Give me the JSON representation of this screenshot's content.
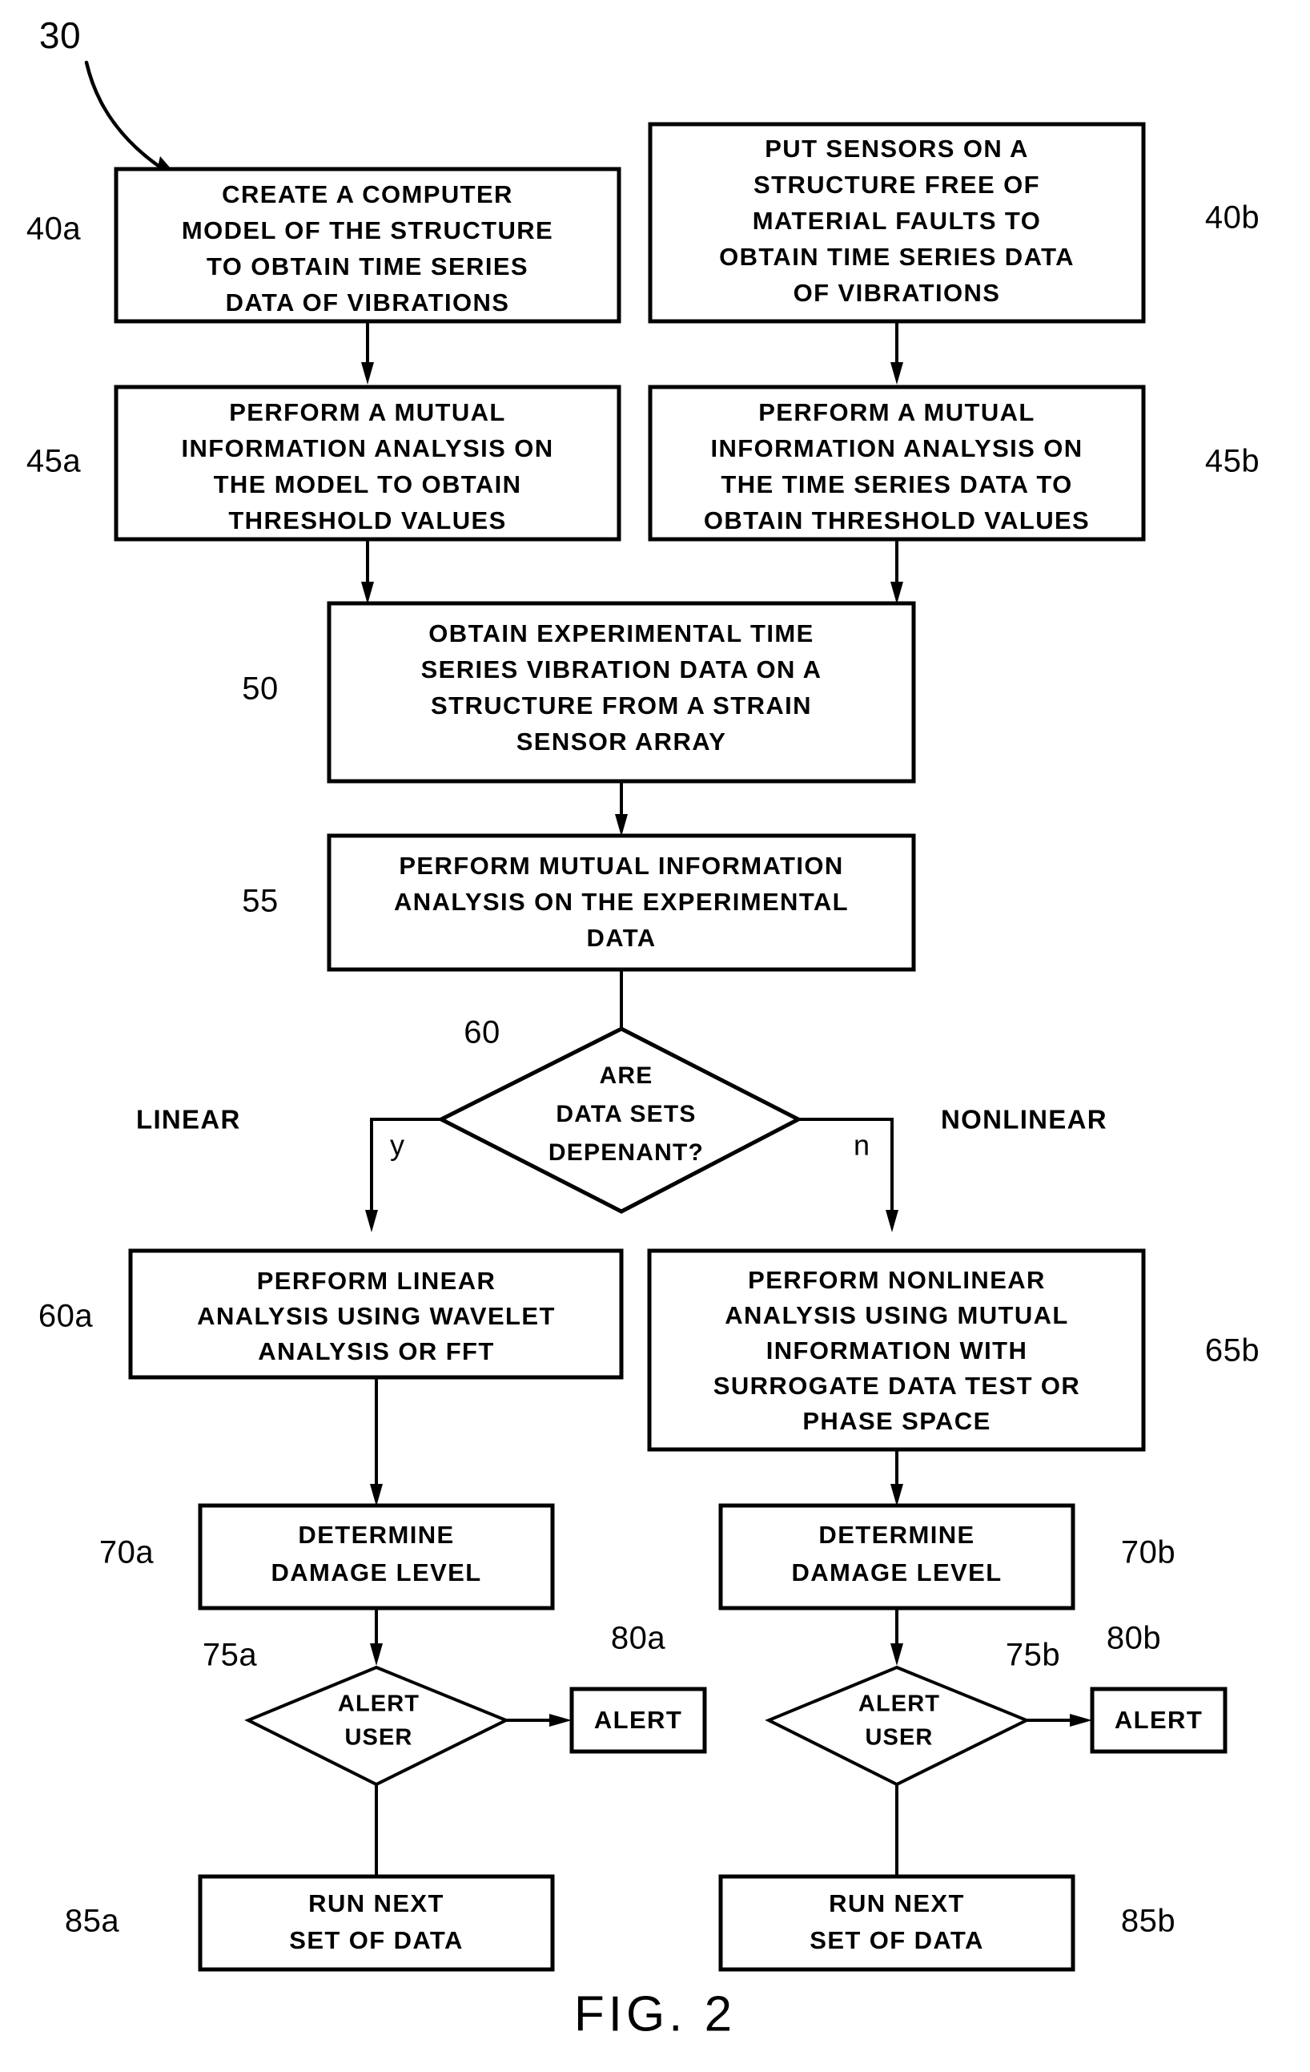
{
  "figure": {
    "caption": "FIG.  2",
    "diagram_ref": "30"
  },
  "nodes": {
    "n40a": {
      "ref": "40a",
      "type": "process",
      "lines": [
        "CREATE A COMPUTER",
        "MODEL OF THE STRUCTURE",
        "TO OBTAIN TIME SERIES",
        "DATA OF VIBRATIONS"
      ]
    },
    "n40b": {
      "ref": "40b",
      "type": "process",
      "lines": [
        "PUT SENSORS ON A",
        "STRUCTURE FREE OF",
        "MATERIAL FAULTS TO",
        "OBTAIN TIME SERIES DATA",
        "OF VIBRATIONS"
      ]
    },
    "n45a": {
      "ref": "45a",
      "type": "process",
      "lines": [
        "PERFORM A MUTUAL",
        "INFORMATION ANALYSIS ON",
        "THE MODEL TO OBTAIN",
        "THRESHOLD VALUES"
      ]
    },
    "n45b": {
      "ref": "45b",
      "type": "process",
      "lines": [
        "PERFORM A MUTUAL",
        "INFORMATION ANALYSIS ON",
        "THE TIME SERIES DATA TO",
        "OBTAIN THRESHOLD VALUES"
      ]
    },
    "n50": {
      "ref": "50",
      "type": "process",
      "lines": [
        "OBTAIN EXPERIMENTAL TIME",
        "SERIES VIBRATION DATA ON A",
        "STRUCTURE FROM A STRAIN",
        "SENSOR ARRAY"
      ]
    },
    "n55": {
      "ref": "55",
      "type": "process",
      "lines": [
        "PERFORM MUTUAL INFORMATION",
        "ANALYSIS ON THE EXPERIMENTAL",
        "DATA"
      ]
    },
    "n60": {
      "ref": "60",
      "type": "decision",
      "lines": [
        "ARE",
        "DATA SETS",
        "DEPENANT?"
      ],
      "branch_yes": "y",
      "branch_no": "n",
      "label_left": "LINEAR",
      "label_right": "NONLINEAR"
    },
    "n60a": {
      "ref": "60a",
      "type": "process",
      "lines": [
        "PERFORM LINEAR",
        "ANALYSIS USING WAVELET",
        "ANALYSIS OR FFT"
      ]
    },
    "n65b": {
      "ref": "65b",
      "type": "process",
      "lines": [
        "PERFORM NONLINEAR",
        "ANALYSIS USING MUTUAL",
        "INFORMATION WITH",
        "SURROGATE DATA TEST OR",
        "PHASE SPACE"
      ]
    },
    "n70a": {
      "ref": "70a",
      "type": "process",
      "lines": [
        "DETERMINE",
        "DAMAGE LEVEL"
      ]
    },
    "n70b": {
      "ref": "70b",
      "type": "process",
      "lines": [
        "DETERMINE",
        "DAMAGE LEVEL"
      ]
    },
    "n75a": {
      "ref": "75a",
      "type": "decision",
      "lines": [
        "ALERT",
        "USER"
      ]
    },
    "n75b": {
      "ref": "75b",
      "type": "decision",
      "lines": [
        "ALERT",
        "USER"
      ]
    },
    "n80a": {
      "ref": "80a",
      "type": "process",
      "lines": [
        "ALERT"
      ]
    },
    "n80b": {
      "ref": "80b",
      "type": "process",
      "lines": [
        "ALERT"
      ]
    },
    "n85a": {
      "ref": "85a",
      "type": "process",
      "lines": [
        "RUN NEXT",
        "SET OF DATA"
      ]
    },
    "n85b": {
      "ref": "85b",
      "type": "process",
      "lines": [
        "RUN NEXT",
        "SET OF DATA"
      ]
    }
  },
  "colors": {
    "ink": "#000000",
    "paper": "#ffffff"
  }
}
